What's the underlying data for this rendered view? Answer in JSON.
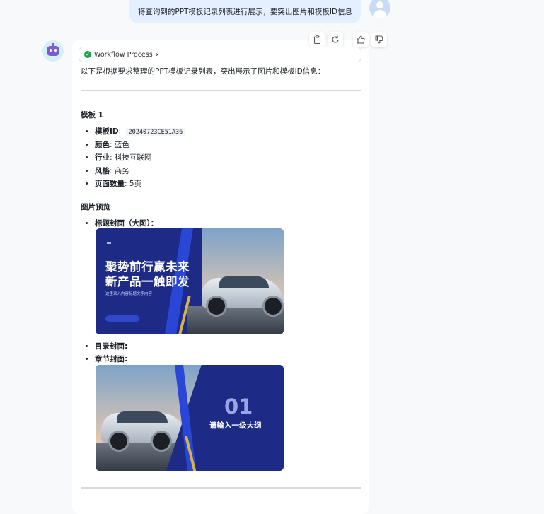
{
  "user_message": "将查询到的PPT模板记录列表进行展示，要突出图片和模板ID信息",
  "workflow": {
    "label": "Workflow Process"
  },
  "toolbar": {
    "copy_icon": "clipboard-icon",
    "regenerate_icon": "refresh-icon",
    "like_icon": "thumbs-up-icon",
    "dislike_icon": "thumbs-down-icon"
  },
  "response": {
    "intro": "以下是根据要求整理的PPT模板记录列表，突出展示了图片和模板ID信息：",
    "template_heading": "模板 1",
    "fields": [
      {
        "label": "模板ID",
        "value": "20240723CE51A36"
      },
      {
        "label": "颜色",
        "value": "蓝色"
      },
      {
        "label": "行业",
        "value": "科技互联网"
      },
      {
        "label": "风格",
        "value": "商务"
      },
      {
        "label": "页面数量",
        "value": "5页"
      }
    ],
    "preview_heading": "图片预览",
    "preview_items": {
      "title_cover": "标题封面（大图）",
      "toc_cover": "目录封面",
      "section_cover": "章节封面"
    },
    "cover_image": {
      "title_line1": "聚势前行赢未来",
      "title_line2": "新产品一触即发",
      "subtitle": "这里录入内容标题文字内容"
    },
    "section_image": {
      "number": "01",
      "title": "请输入一级大纲"
    }
  }
}
